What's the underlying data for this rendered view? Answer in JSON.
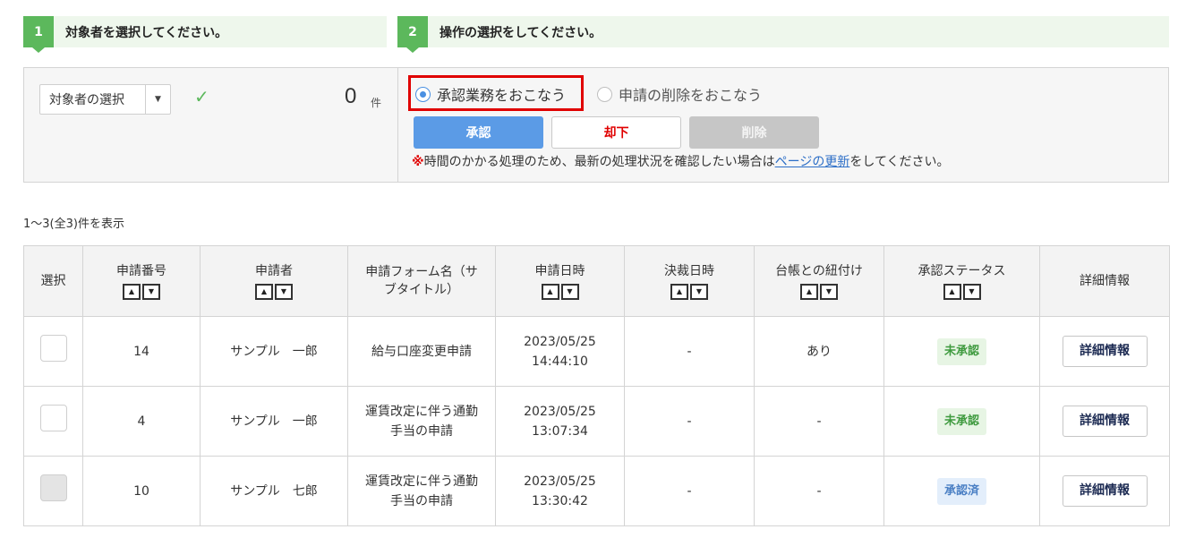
{
  "steps": [
    {
      "number": "1",
      "title": "対象者を選択してください。"
    },
    {
      "number": "2",
      "title": "操作の選択をしてください。"
    }
  ],
  "target": {
    "select_value": "対象者の選択",
    "count": "0",
    "count_unit": "件"
  },
  "operation": {
    "radio_approve": "承認業務をおこなう",
    "radio_delete": "申請の削除をおこなう",
    "btn_approve": "承認",
    "btn_reject": "却下",
    "btn_delete": "削除",
    "notice_mark": "※",
    "notice_before": "時間のかかる処理のため、最新の処理状況を確認したい場合は",
    "notice_link": "ページの更新",
    "notice_after": "をしてください。",
    "selected": "approve"
  },
  "result_count": "1〜3(全3)件を表示",
  "table": {
    "headers": {
      "select": "選択",
      "app_no": "申請番号",
      "applicant": "申請者",
      "form_name_1": "申請フォーム名（サ",
      "form_name_2": "ブタイトル）",
      "app_date": "申請日時",
      "decision_date": "決裁日時",
      "ledger": "台帳との紐付け",
      "status": "承認ステータス",
      "detail": "詳細情報"
    },
    "rows": [
      {
        "no": "14",
        "applicant": "サンプル　一郎",
        "form1": "給与口座変更申請",
        "form2": "",
        "date1": "2023/05/25",
        "date2": "14:44:10",
        "decision": "-",
        "ledger": "あり",
        "status": "未承認",
        "detail": "詳細情報"
      },
      {
        "no": "4",
        "applicant": "サンプル　一郎",
        "form1": "運賃改定に伴う通勤",
        "form2": "手当の申請",
        "date1": "2023/05/25",
        "date2": "13:07:34",
        "decision": "-",
        "ledger": "-",
        "status": "未承認",
        "detail": "詳細情報"
      },
      {
        "no": "10",
        "applicant": "サンプル　七郎",
        "form1": "運賃改定に伴う通勤",
        "form2": "手当の申請",
        "date1": "2023/05/25",
        "date2": "13:30:42",
        "decision": "-",
        "ledger": "-",
        "status": "承認済",
        "detail": "詳細情報"
      }
    ]
  },
  "colors": {
    "accent_green": "#5cb85c",
    "approve_blue": "#5b9be6",
    "reject_red": "#e00000",
    "highlight_red": "#e00000"
  }
}
